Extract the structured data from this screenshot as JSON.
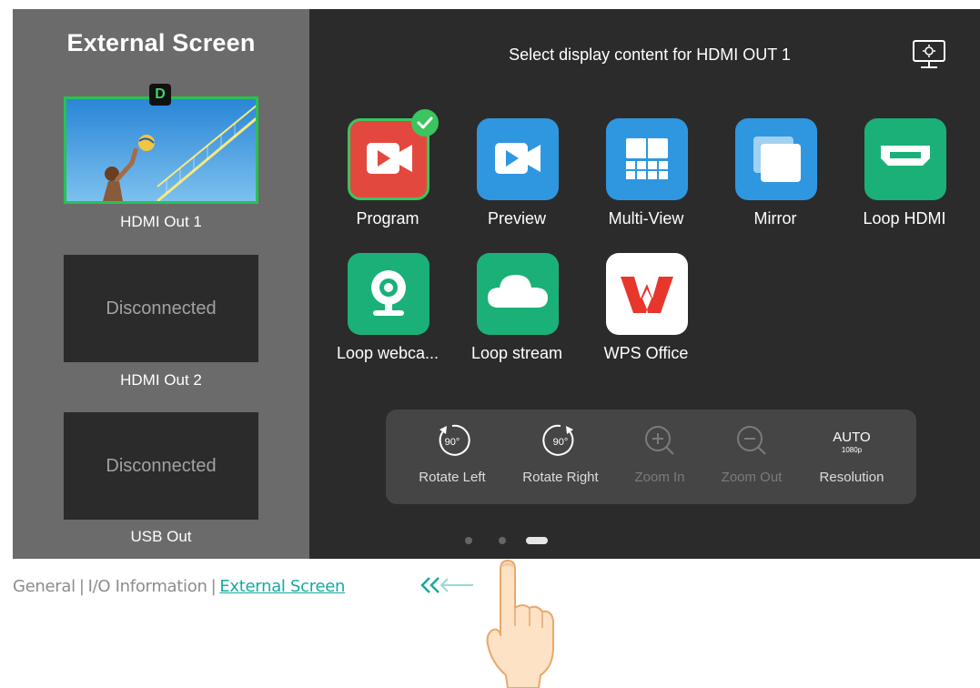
{
  "sidebar": {
    "title": "External Screen",
    "badge": "D",
    "outputs": [
      {
        "label": "HDMI Out 1",
        "status": "",
        "active": true
      },
      {
        "label": "HDMI Out 2",
        "status": "Disconnected",
        "active": false
      },
      {
        "label": "USB Out",
        "status": "Disconnected",
        "active": false
      }
    ]
  },
  "main": {
    "title": "Select display content for HDMI OUT 1",
    "settings_icon": "display-settings-icon",
    "apps": [
      {
        "label": "Program",
        "icon": "program-camera-icon",
        "color": "#e3483e",
        "selected": true
      },
      {
        "label": "Preview",
        "icon": "preview-camera-icon",
        "color": "#2f97e0",
        "selected": false
      },
      {
        "label": "Multi-View",
        "icon": "multi-view-grid-icon",
        "color": "#2f97e0",
        "selected": false
      },
      {
        "label": "Mirror",
        "icon": "mirror-windows-icon",
        "color": "#2f97e0",
        "selected": false
      },
      {
        "label": "Loop HDMI",
        "icon": "hdmi-port-icon",
        "color": "#1bb077",
        "selected": false
      },
      {
        "label": "Loop webca...",
        "icon": "webcam-icon",
        "color": "#1bb077",
        "selected": false
      },
      {
        "label": "Loop stream",
        "icon": "cloud-icon",
        "color": "#1bb077",
        "selected": false
      },
      {
        "label": "WPS Office",
        "icon": "wps-office-logo-icon",
        "color": "#ffffff",
        "selected": false
      }
    ],
    "toolbar": [
      {
        "label": "Rotate Left",
        "icon": "rotate-left-90-icon",
        "icon_text": "90°",
        "enabled": true
      },
      {
        "label": "Rotate Right",
        "icon": "rotate-right-90-icon",
        "icon_text": "90°",
        "enabled": true
      },
      {
        "label": "Zoom In",
        "icon": "zoom-in-icon",
        "enabled": false
      },
      {
        "label": "Zoom Out",
        "icon": "zoom-out-icon",
        "enabled": false
      },
      {
        "label": "Resolution",
        "icon": "auto-resolution-icon",
        "icon_text": "AUTO",
        "icon_subtext": "1080p",
        "enabled": true
      }
    ],
    "pager": {
      "pages": 3,
      "current": 3
    }
  },
  "breadcrumb": {
    "items": [
      "General",
      "I/O Information",
      "External Screen"
    ],
    "separator": "|",
    "current_index": 2
  },
  "colors": {
    "accent_green": "#27c251",
    "link_teal": "#17a9a2",
    "screen_bg": "#2b2b2b",
    "sidebar_bg": "#6b6b6b"
  }
}
